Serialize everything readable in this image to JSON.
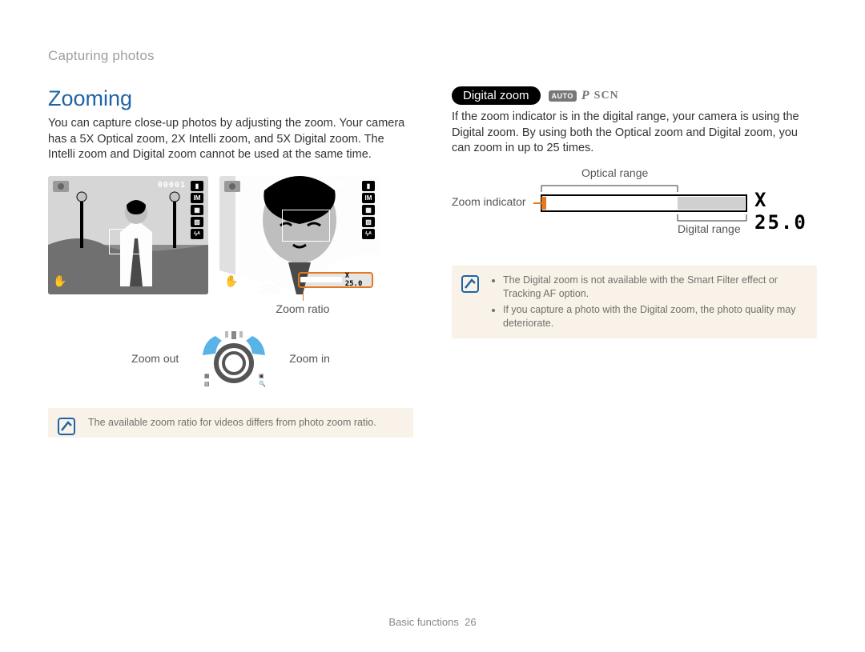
{
  "header": {
    "section": "Capturing photos"
  },
  "left": {
    "title": "Zooming",
    "intro": "You can capture close-up photos by adjusting the zoom. Your camera has a 5X Optical zoom, 2X Intelli zoom, and 5X Digital zoom. The Intelli zoom and Digital zoom cannot be used at the same time.",
    "shot_counter": "00001",
    "zoom_bar_ratio": "X 25.0",
    "labels": {
      "zoom_ratio": "Zoom ratio",
      "zoom_out": "Zoom out",
      "zoom_in": "Zoom in"
    },
    "note": "The available zoom ratio for videos differs from photo zoom ratio."
  },
  "right": {
    "pill": "Digital zoom",
    "modes": {
      "auto": "AUTO",
      "p": "P",
      "scn": "SCN"
    },
    "paragraph": "If the zoom indicator is in the digital range, your camera is using the Digital zoom. By using both the Optical zoom and Digital zoom, you can zoom in up to 25 times.",
    "labels": {
      "optical_range": "Optical range",
      "zoom_indicator": "Zoom indicator",
      "digital_range": "Digital range",
      "max_zoom": "X 25.0"
    },
    "notes": [
      "The Digital zoom is not available with the Smart Filter effect or Tracking AF option.",
      "If you capture a photo with the Digital zoom, the photo quality may deteriorate."
    ]
  },
  "footer": {
    "chapter": "Basic functions",
    "page": "26"
  }
}
